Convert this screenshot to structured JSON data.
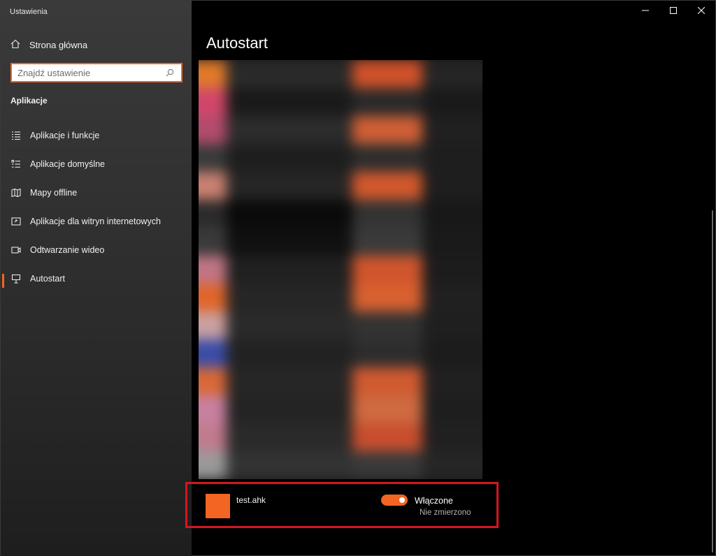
{
  "window": {
    "title": "Ustawienia"
  },
  "sidebar": {
    "home_label": "Strona główna",
    "search_placeholder": "Znajdź ustawienie",
    "section_heading": "Aplikacje",
    "items": [
      {
        "label": "Aplikacje i funkcje",
        "icon": "apps-features-icon"
      },
      {
        "label": "Aplikacje domyślne",
        "icon": "default-apps-icon"
      },
      {
        "label": "Mapy offline",
        "icon": "offline-maps-icon"
      },
      {
        "label": "Aplikacje dla witryn internetowych",
        "icon": "apps-for-websites-icon"
      },
      {
        "label": "Odtwarzanie wideo",
        "icon": "video-playback-icon"
      },
      {
        "label": "Autostart",
        "icon": "startup-icon",
        "active": true
      }
    ]
  },
  "main": {
    "title": "Autostart",
    "app": {
      "name": "test.ahk",
      "toggle_state": "Włączone",
      "impact": "Nie zmierzono",
      "enabled": true
    }
  },
  "colors": {
    "accent": "#f26522",
    "highlight": "#d4161f",
    "background": "#000000",
    "sidebar": "#2b2b2b"
  }
}
